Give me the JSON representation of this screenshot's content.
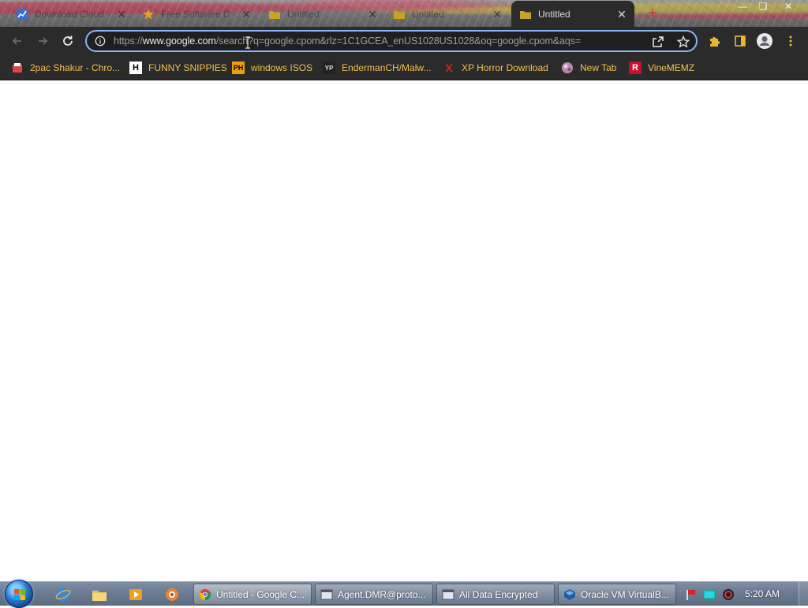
{
  "tabs": [
    {
      "title": "Download Cloud...",
      "favicon": "chart-icon",
      "active": false
    },
    {
      "title": "Free Software D...",
      "favicon": "star-icon",
      "active": false
    },
    {
      "title": "Untitled",
      "favicon": "folder-icon",
      "active": false
    },
    {
      "title": "Untitled",
      "favicon": "folder-icon",
      "active": false
    },
    {
      "title": "Untitled",
      "favicon": "folder-icon",
      "active": true
    }
  ],
  "omnibox": {
    "scheme": "https://",
    "host": "www.google.com",
    "path": "/search?q=google.cpom&rlz=1C1GCEA_enUS1028US1028&oq=google.cpom&aqs="
  },
  "bookmarks": [
    {
      "label": "2pac Shakur - Chro...",
      "icon": "document-icon"
    },
    {
      "label": "FUNNY SNIPPIES",
      "icon": "h-logo-icon"
    },
    {
      "label": "windows ISOS",
      "icon": "ph-logo-icon"
    },
    {
      "label": "EndermanCH/Malw...",
      "icon": "yp-logo-icon"
    },
    {
      "label": "XP Horror Download",
      "icon": "x-logo-icon"
    },
    {
      "label": "New Tab",
      "icon": "globe-icon"
    },
    {
      "label": "VineMEMZ",
      "icon": "r-logo-icon"
    }
  ],
  "taskbar": {
    "tasks": [
      {
        "label": "Untitled - Google C...",
        "icon": "chrome-icon",
        "active": true
      },
      {
        "label": "Agent.DMR@proto...",
        "icon": "window-icon",
        "active": false
      },
      {
        "label": "All Data Encrypted",
        "icon": "window-icon",
        "active": false
      },
      {
        "label": "Oracle VM VirtualB...",
        "icon": "virtualbox-icon",
        "active": false
      }
    ],
    "clock": "5:20 AM"
  },
  "colors": {
    "toolbar_bg": "#2b2b2b",
    "omnibox_border": "#8ab4f8",
    "bookmark_text": "#f2c14e",
    "page_bg": "#ffffff"
  }
}
